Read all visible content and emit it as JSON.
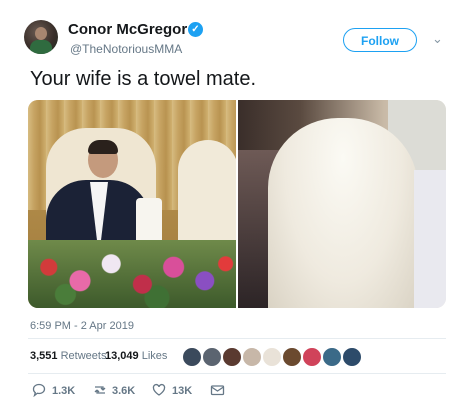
{
  "author": {
    "name": "Conor McGregor",
    "handle": "@TheNotoriousMMA",
    "verified_glyph": "✓"
  },
  "follow_button": {
    "label": "Follow"
  },
  "menu_chevron": "⌄",
  "tweet": {
    "text": "Your wife is a towel mate.",
    "timestamp": "6:59 PM - 2 Apr 2019"
  },
  "stats": {
    "retweets_count": "3,551",
    "retweets_label": "Retweets",
    "likes_count": "13,049",
    "likes_label": "Likes"
  },
  "liker_colors": [
    "#3b4a5c",
    "#5b6470",
    "#5a3a30",
    "#c7b7a8",
    "#e9e2d8",
    "#6b4a2f",
    "#d0435a",
    "#3b6a88",
    "#2d4b6a"
  ],
  "actions": {
    "reply": {
      "icon": "speech-bubble-icon",
      "glyph": "💬",
      "count": "1.3K"
    },
    "retweet": {
      "icon": "retweet-icon",
      "glyph": "⇄",
      "count": "3.6K"
    },
    "like": {
      "icon": "heart-icon",
      "glyph": "♡",
      "count": "13K"
    },
    "message": {
      "icon": "envelope-icon",
      "glyph": "✉"
    }
  },
  "colors": {
    "accent": "#1da1f2",
    "secondary_text": "#657786",
    "primary_text": "#14171a"
  }
}
